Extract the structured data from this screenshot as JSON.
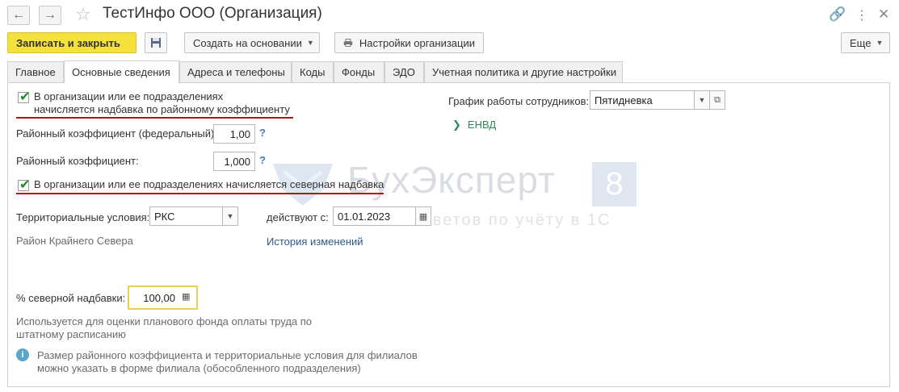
{
  "window": {
    "title": "ТестИнфо ООО (Организация)"
  },
  "toolbar": {
    "save_close": "Записать и закрыть",
    "create_based": "Создать на основании",
    "org_settings": "Настройки организации",
    "more": "Еще"
  },
  "tabs": [
    {
      "label": "Главное"
    },
    {
      "label": "Основные сведения"
    },
    {
      "label": "Адреса и телефоны"
    },
    {
      "label": "Коды"
    },
    {
      "label": "Фонды"
    },
    {
      "label": "ЭДО"
    },
    {
      "label": "Учетная политика и другие настройки"
    }
  ],
  "form": {
    "regional_checkbox_line1": "В организации или ее подразделениях",
    "regional_checkbox_line2": "начисляется надбавка по районному коэффициенту",
    "regional_checked": true,
    "federal_coef_label": "Районный коэффициент (федеральный):",
    "federal_coef_value": "1,00",
    "coef_label": "Районный коэффициент:",
    "coef_value": "1,000",
    "help_mark": "?",
    "northern_checkbox": "В организации или ее подразделениях начисляется северная надбавка",
    "northern_checked": true,
    "territory_label": "Территориальные условия:",
    "territory_value": "РКС",
    "effective_label": "действуют с:",
    "effective_value": "01.01.2023",
    "territory_desc": "Район Крайнего Севера",
    "history_link": "История изменений",
    "northern_pct_label": "% северной надбавки:",
    "northern_pct_value": "100,00",
    "usage_note_line1": "Используется для оценки планового фонда оплаты труда по",
    "usage_note_line2": "штатному расписанию",
    "info_line1": "Размер районного коэффициента и территориальные условия для филиалов",
    "info_line2": "можно указать в форме филиала (обособленного подразделения)",
    "schedule_label": "График работы сотрудников:",
    "schedule_value": "Пятидневка",
    "envd_label": "ЕНВД"
  },
  "watermark": {
    "brand": "БухЭксперт",
    "badge": "8",
    "tagline": "База ответов по учёту в 1С"
  },
  "colors": {
    "accent_yellow": "#f4e13b",
    "underline_red": "#b3121b",
    "link_blue": "#2b5a8a",
    "check_green": "#1f8a2e"
  }
}
